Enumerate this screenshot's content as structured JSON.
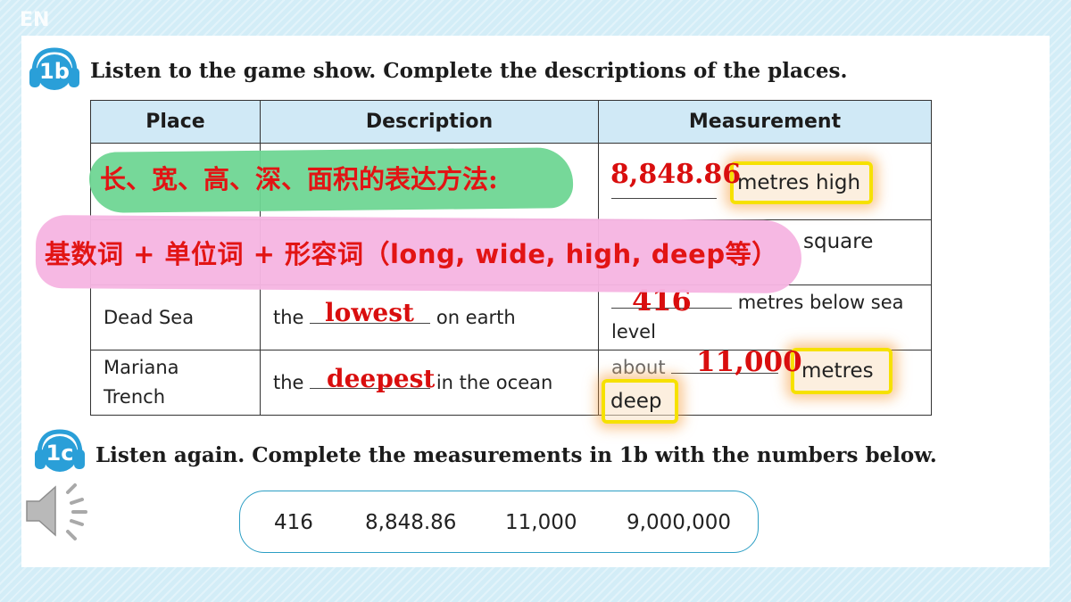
{
  "corner_label": "EN",
  "section_1b": {
    "badge": "1b",
    "instruction": "Listen to the game show. Complete the descriptions of the places."
  },
  "table": {
    "headers": [
      "Place",
      "Description",
      "Measurement"
    ],
    "rows": [
      {
        "place": "",
        "desc_pre": "",
        "desc_post": "",
        "measure": "metres high"
      },
      {
        "place": "",
        "desc_pre": "",
        "desc_post": "",
        "measure": "square"
      },
      {
        "place": "Dead Sea",
        "desc_pre": "the",
        "desc_post": "on earth",
        "measure_line1": "metres below sea",
        "measure_line2": "level"
      },
      {
        "place_line1": "Mariana",
        "place_line2": "Trench",
        "desc_pre": "the",
        "desc_post": "in the ocean",
        "measure_pre": "about",
        "measure_unit": "metres",
        "measure_adj": "deep"
      }
    ]
  },
  "answers": {
    "everest_height": "8,848.86",
    "dead_sea_desc": "lowest",
    "dead_sea_depth": "416",
    "trench_desc": "deepest",
    "trench_depth": "11,000"
  },
  "notes": {
    "green": "长、宽、高、深、面积的表达方法:",
    "pink": "基数词 + 单位词 + 形容词（long, wide, high, deep等）"
  },
  "section_1c": {
    "badge": "1c",
    "instruction": "Listen again. Complete the measurements in 1b with the numbers below.",
    "numbers": [
      "416",
      "8,848.86",
      "11,000",
      "9,000,000"
    ]
  },
  "colors": {
    "answer_red": "#d90e0e",
    "badge_blue": "#2a9fd8",
    "header_blue": "#d0e9f6",
    "highlight_yellow": "#f6e100",
    "green_note": "#6fd694",
    "pink_note": "#f6b5e2"
  },
  "icons": [
    "speaker-icon",
    "headphones-icon"
  ]
}
